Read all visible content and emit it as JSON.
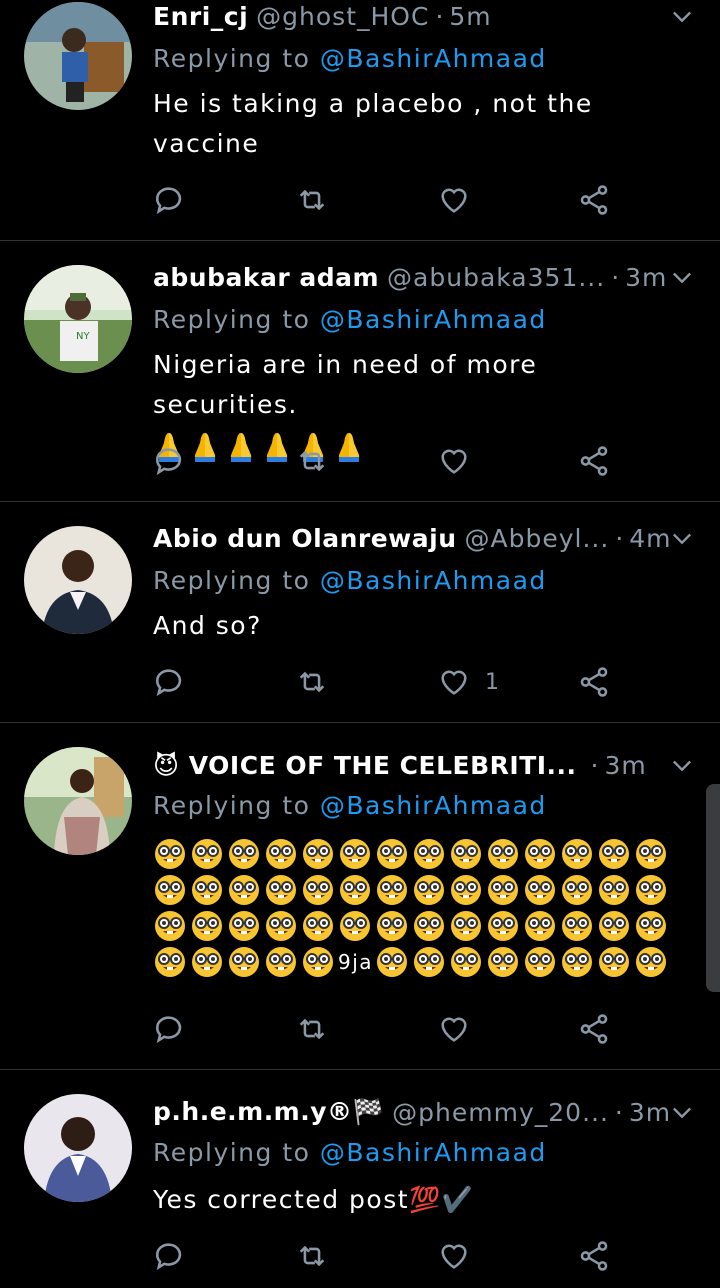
{
  "tweets": [
    {
      "name": "Enri_cj",
      "handle": "@ghost_HOC",
      "time": "5m",
      "replying_prefix": "Replying to",
      "replying_to": "@BashirAhmaad",
      "text_lines": [
        "He is taking a placebo , not the",
        "vaccine"
      ],
      "likes": ""
    },
    {
      "name": "abubakar adam",
      "handle": "@abubaka351...",
      "time": "3m",
      "replying_prefix": "Replying to",
      "replying_to": "@BashirAhmaad",
      "text_lines": [
        "Nigeria are in need of more securities."
      ],
      "emoji_line": "🙏🙏🙏🙏🙏🙏",
      "likes": ""
    },
    {
      "name": "Abio dun Olanrewaju",
      "handle": "@Abbeyl...",
      "time": "4m",
      "replying_prefix": "Replying to",
      "replying_to": "@BashirAhmaad",
      "text_lines": [
        "And so?"
      ],
      "likes": "1"
    },
    {
      "name": "😈 VOICE OF THE CELEBRITI...",
      "handle": "",
      "time": "3m",
      "replying_prefix": "Replying to",
      "replying_to": "@BashirAhmaad",
      "inline_text": "9ja",
      "likes": ""
    },
    {
      "name": "p.h.e.m.m.y®🏁",
      "handle": "@phemmy_20...",
      "time": "3m",
      "replying_prefix": "Replying to",
      "replying_to": "@BashirAhmaad",
      "text_lines": [
        "Yes corrected post💯✔️"
      ],
      "likes": ""
    }
  ],
  "icons": [
    "reply-icon",
    "retweet-icon",
    "like-icon",
    "share-icon",
    "chevron-down-icon"
  ],
  "colors": {
    "background": "#000000",
    "link": "#1d9bf0",
    "muted": "#8b98a5",
    "divider": "#2f3336"
  }
}
